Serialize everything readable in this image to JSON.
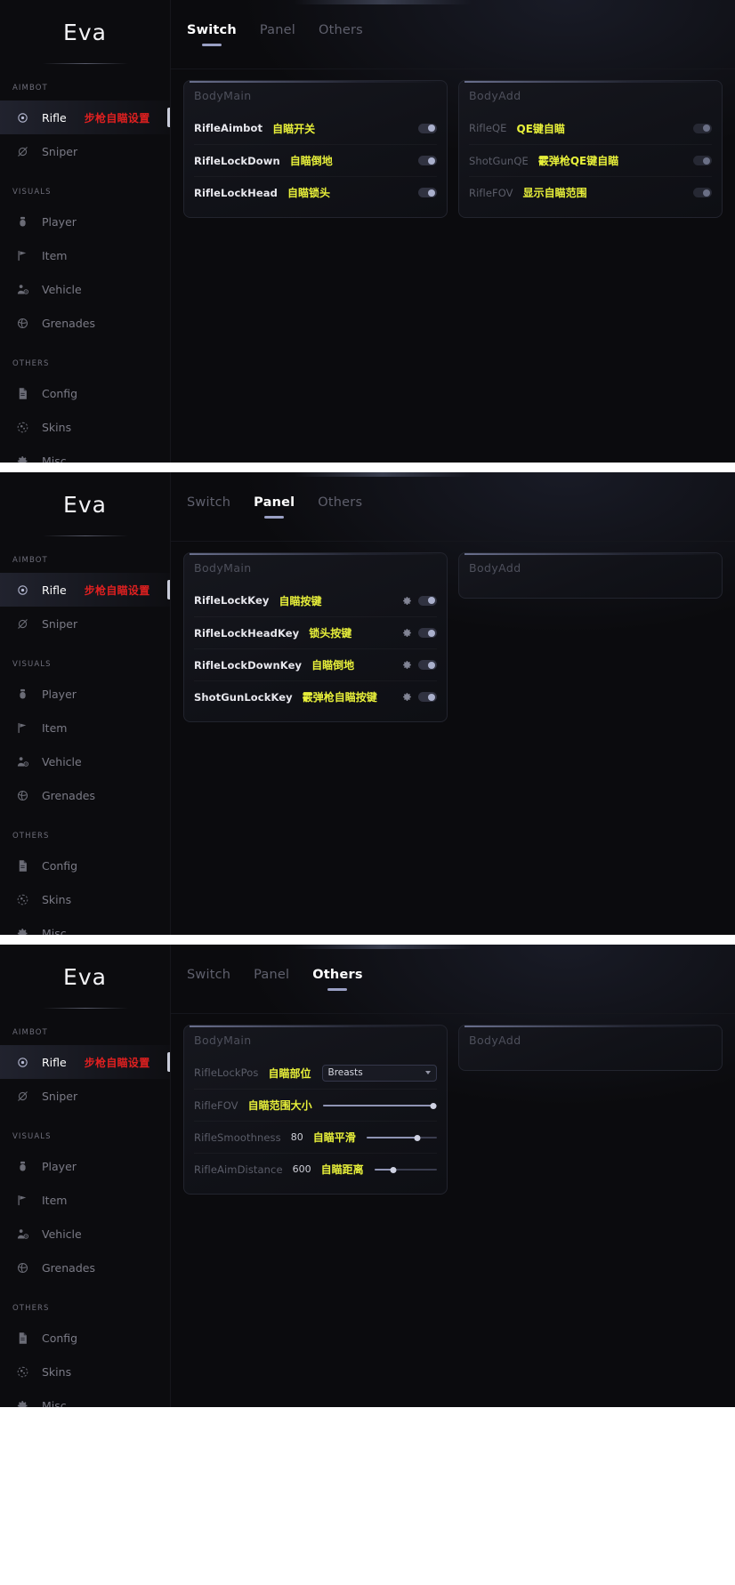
{
  "app": {
    "brand": "Eva"
  },
  "sidebar": {
    "sections": [
      {
        "label": "AIMBOT",
        "items": [
          {
            "label": "Rifle",
            "icon": "crosshair-icon",
            "note": "步枪自瞄设置",
            "active": true
          },
          {
            "label": "Sniper",
            "icon": "scope-off-icon",
            "note": "",
            "active": false
          }
        ]
      },
      {
        "label": "VISUALS",
        "items": [
          {
            "label": "Player",
            "icon": "player-icon",
            "note": "",
            "active": false
          },
          {
            "label": "Item",
            "icon": "item-flag-icon",
            "note": "",
            "active": false
          },
          {
            "label": "Vehicle",
            "icon": "vehicle-icon",
            "note": "",
            "active": false
          },
          {
            "label": "Grenades",
            "icon": "grenade-icon",
            "note": "",
            "active": false
          }
        ]
      },
      {
        "label": "OTHERS",
        "items": [
          {
            "label": "Config",
            "icon": "config-file-icon",
            "note": "",
            "active": false
          },
          {
            "label": "Skins",
            "icon": "skins-icon",
            "note": "",
            "active": false
          },
          {
            "label": "Misc",
            "icon": "gear-icon",
            "note": "",
            "active": false
          }
        ]
      }
    ]
  },
  "tabs": [
    "Switch",
    "Panel",
    "Others"
  ],
  "colors": {
    "accent_yellow": "#e8f03a",
    "accent_red": "#e02020",
    "tab_underline": "#9aa0c4",
    "toggle_knob_on": "#aab0cc"
  },
  "views": [
    {
      "active_tab": "Switch",
      "cards": [
        {
          "title": "BodyMain",
          "rows": [
            {
              "key": "RifleAimbot",
              "cn": "自瞄开关",
              "control": "toggle",
              "toggle_on": true,
              "dim": false
            },
            {
              "key": "RifleLockDown",
              "cn": "自瞄倒地",
              "control": "toggle",
              "toggle_on": true,
              "dim": false
            },
            {
              "key": "RifleLockHead",
              "cn": "自瞄锁头",
              "control": "toggle",
              "toggle_on": true,
              "dim": false
            }
          ]
        },
        {
          "title": "BodyAdd",
          "rows": [
            {
              "key": "RifleQE",
              "cn": "QE键自瞄",
              "control": "toggle",
              "toggle_on": false,
              "dim": true
            },
            {
              "key": "ShotGunQE",
              "cn": "霰弹枪QE键自瞄",
              "control": "toggle",
              "toggle_on": false,
              "dim": true
            },
            {
              "key": "RifleFOV",
              "cn": "显示自瞄范围",
              "control": "toggle",
              "toggle_on": false,
              "dim": true
            }
          ]
        }
      ]
    },
    {
      "active_tab": "Panel",
      "cards": [
        {
          "title": "BodyMain",
          "rows": [
            {
              "key": "RifleLockKey",
              "cn": "自瞄按键",
              "control": "gear-toggle",
              "toggle_on": true,
              "dim": false
            },
            {
              "key": "RifleLockHeadKey",
              "cn": "锁头按键",
              "control": "gear-toggle",
              "toggle_on": true,
              "dim": false
            },
            {
              "key": "RifleLockDownKey",
              "cn": "自瞄倒地",
              "control": "gear-toggle",
              "toggle_on": true,
              "dim": false
            },
            {
              "key": "ShotGunLockKey",
              "cn": "霰弹枪自瞄按键",
              "control": "gear-toggle",
              "toggle_on": true,
              "dim": false
            }
          ]
        },
        {
          "title": "BodyAdd",
          "rows": []
        }
      ]
    },
    {
      "active_tab": "Others",
      "cards": [
        {
          "title": "BodyMain",
          "rows": [
            {
              "key": "RifleLockPos",
              "cn": "自瞄部位",
              "control": "dropdown",
              "value": "Breasts",
              "dim": true
            },
            {
              "key": "RifleFOV",
              "cn": "自瞄范围大小",
              "control": "slider",
              "value": "",
              "percent": 97,
              "dim": true
            },
            {
              "key": "RifleSmoothness",
              "cn": "自瞄平滑",
              "control": "slider",
              "value": "80",
              "percent": 72,
              "dim": true
            },
            {
              "key": "RifleAimDistance",
              "cn": "自瞄距离",
              "control": "slider",
              "value": "600",
              "percent": 30,
              "dim": true
            }
          ]
        },
        {
          "title": "BodyAdd",
          "rows": []
        }
      ]
    }
  ]
}
